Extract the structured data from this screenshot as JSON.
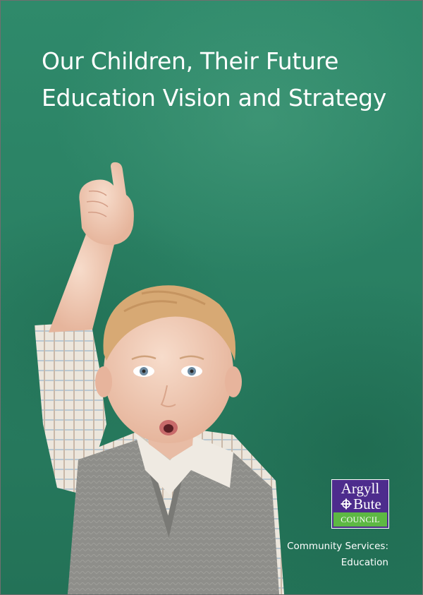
{
  "cover": {
    "title_line1": "Our Children, Their Future",
    "title_line2": "Education Vision and Strategy",
    "department_line1": "Community Services:",
    "department_line2": "Education",
    "photo": "child-raising-finger-chalkboard"
  },
  "logo": {
    "line1": "Argyll",
    "line2": "Bute",
    "band": "COUNCIL",
    "icon": "celtic-cross-ampersand-icon",
    "colors": {
      "panel": "#4d2c8d",
      "band": "#5db843"
    }
  },
  "colors": {
    "chalkboard": "#2a8063",
    "text": "#ffffff"
  }
}
